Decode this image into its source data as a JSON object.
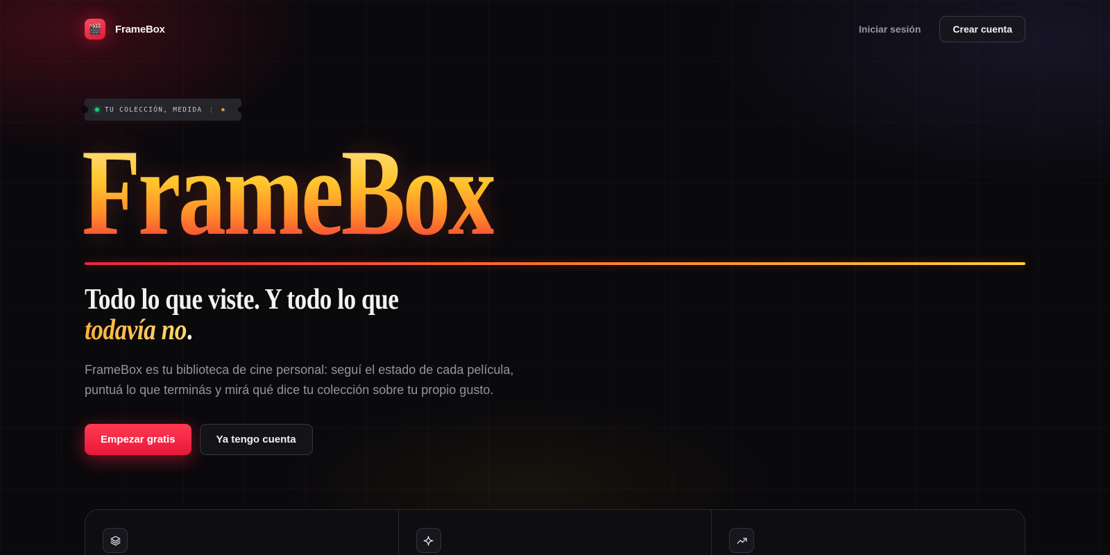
{
  "nav": {
    "logo_emoji": "🎬",
    "brand": "FrameBox",
    "signin_label": "Iniciar sesión",
    "create_account_label": "Crear cuenta"
  },
  "hero": {
    "badge_text": "TU COLECCIÓN, MEDIDA",
    "badge_separator": "¦",
    "badge_star": "★",
    "title": "FrameBox",
    "tagline_line1": "Todo lo que viste. Y todo lo que",
    "tagline_accent": "todavía no",
    "tagline_end": ".",
    "description": "FrameBox es tu biblioteca de cine personal: seguí el estado de cada película, puntuá lo que terminás y mirá qué dice tu colección sobre tu propio gusto.",
    "primary_cta": "Empezar gratis",
    "secondary_cta": "Ya tengo cuenta"
  },
  "features": [
    {
      "icon": "layers-icon"
    },
    {
      "icon": "sparkle-icon"
    },
    {
      "icon": "trending-up-icon"
    }
  ],
  "colors": {
    "accent_red": "#ee2442",
    "accent_gold": "#ffd23b",
    "status_green": "#23c57a",
    "background": "#0a090c"
  }
}
